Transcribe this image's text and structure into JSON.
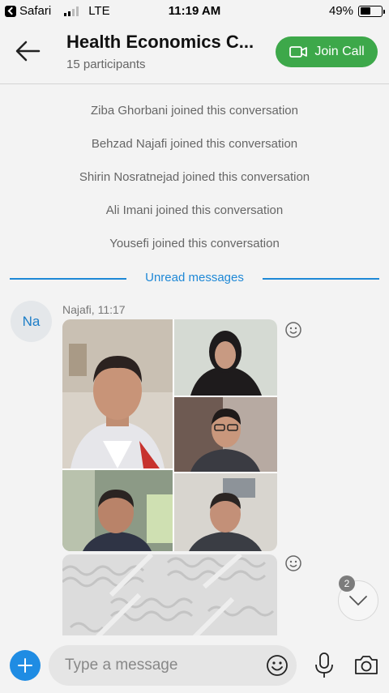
{
  "status_bar": {
    "carrier": "Safari",
    "network": "LTE",
    "time": "11:19 AM",
    "battery": "49%",
    "battery_level": 0.49,
    "signal_bars_filled": 2,
    "signal_bars_total": 4
  },
  "header": {
    "title": "Health Economics C...",
    "subtitle": "15 participants",
    "join_call_label": "Join Call"
  },
  "chat": {
    "system_messages": [
      "Ziba Ghorbani joined this conversation",
      "Behzad Najafi joined this conversation",
      "Shirin Nosratnejad joined this conversation",
      "Ali Imani joined this conversation",
      "Yousefi joined this conversation"
    ],
    "unread_divider": "Unread messages",
    "message": {
      "avatar_initials": "Na",
      "sender_time": "Najafi, 11:17"
    },
    "scroll_badge": "2"
  },
  "composer": {
    "placeholder": "Type a message"
  },
  "colors": {
    "accent": "#1e88d6",
    "join_green": "#3da84a",
    "plus_blue": "#1f8ce3"
  },
  "icons": [
    "back-arrow-icon",
    "video-call-icon",
    "smiley-icon",
    "chevron-down-icon",
    "plus-icon",
    "emoji-icon",
    "microphone-icon",
    "camera-icon"
  ]
}
